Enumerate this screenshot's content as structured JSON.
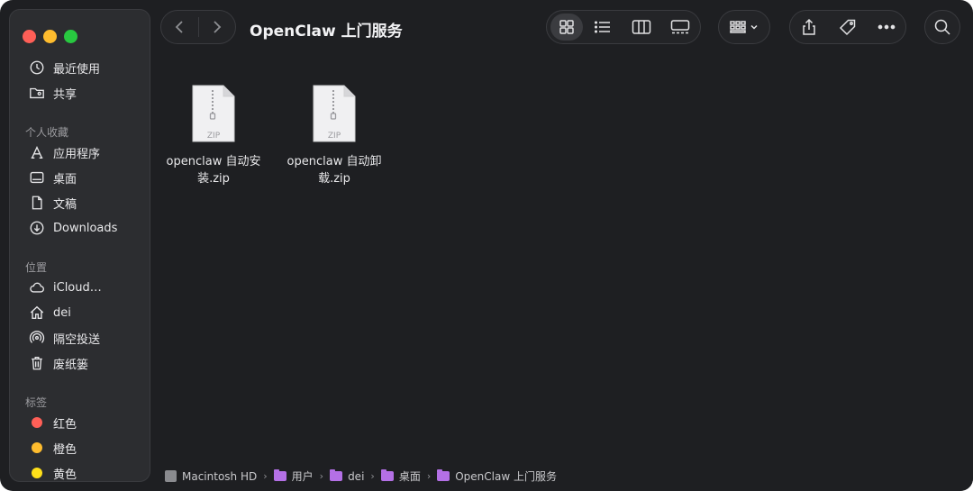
{
  "sidebar": {
    "sections": {
      "favorites": "个人收藏",
      "locations": "位置",
      "tags": "标签"
    },
    "top_items": [
      {
        "label": "最近使用",
        "icon": "clock-icon"
      },
      {
        "label": "共享",
        "icon": "shared-folder-icon"
      }
    ],
    "favorites": [
      {
        "label": "应用程序",
        "icon": "applications-icon"
      },
      {
        "label": "桌面",
        "icon": "desktop-icon"
      },
      {
        "label": "文稿",
        "icon": "document-icon"
      },
      {
        "label": "Downloads",
        "icon": "download-icon"
      }
    ],
    "locations": [
      {
        "label": "iCloud…",
        "icon": "cloud-icon"
      },
      {
        "label": "dei",
        "icon": "home-icon"
      },
      {
        "label": "隔空投送",
        "icon": "airdrop-icon"
      },
      {
        "label": "废纸篓",
        "icon": "trash-icon"
      }
    ],
    "tags": [
      {
        "label": "红色",
        "color": "#ff5f57"
      },
      {
        "label": "橙色",
        "color": "#febc2e"
      },
      {
        "label": "黄色",
        "color": "#ffe01a"
      }
    ]
  },
  "toolbar": {
    "title": "OpenClaw 上门服务"
  },
  "files": [
    {
      "name_line1": "openclaw 自动安",
      "name_line2": "装.zip",
      "badge": "ZIP"
    },
    {
      "name_line1": "openclaw 自动卸",
      "name_line2": "载.zip",
      "badge": "ZIP"
    }
  ],
  "pathbar": {
    "crumbs": [
      "Macintosh HD",
      "用户",
      "dei",
      "桌面",
      "OpenClaw 上门服务"
    ]
  }
}
